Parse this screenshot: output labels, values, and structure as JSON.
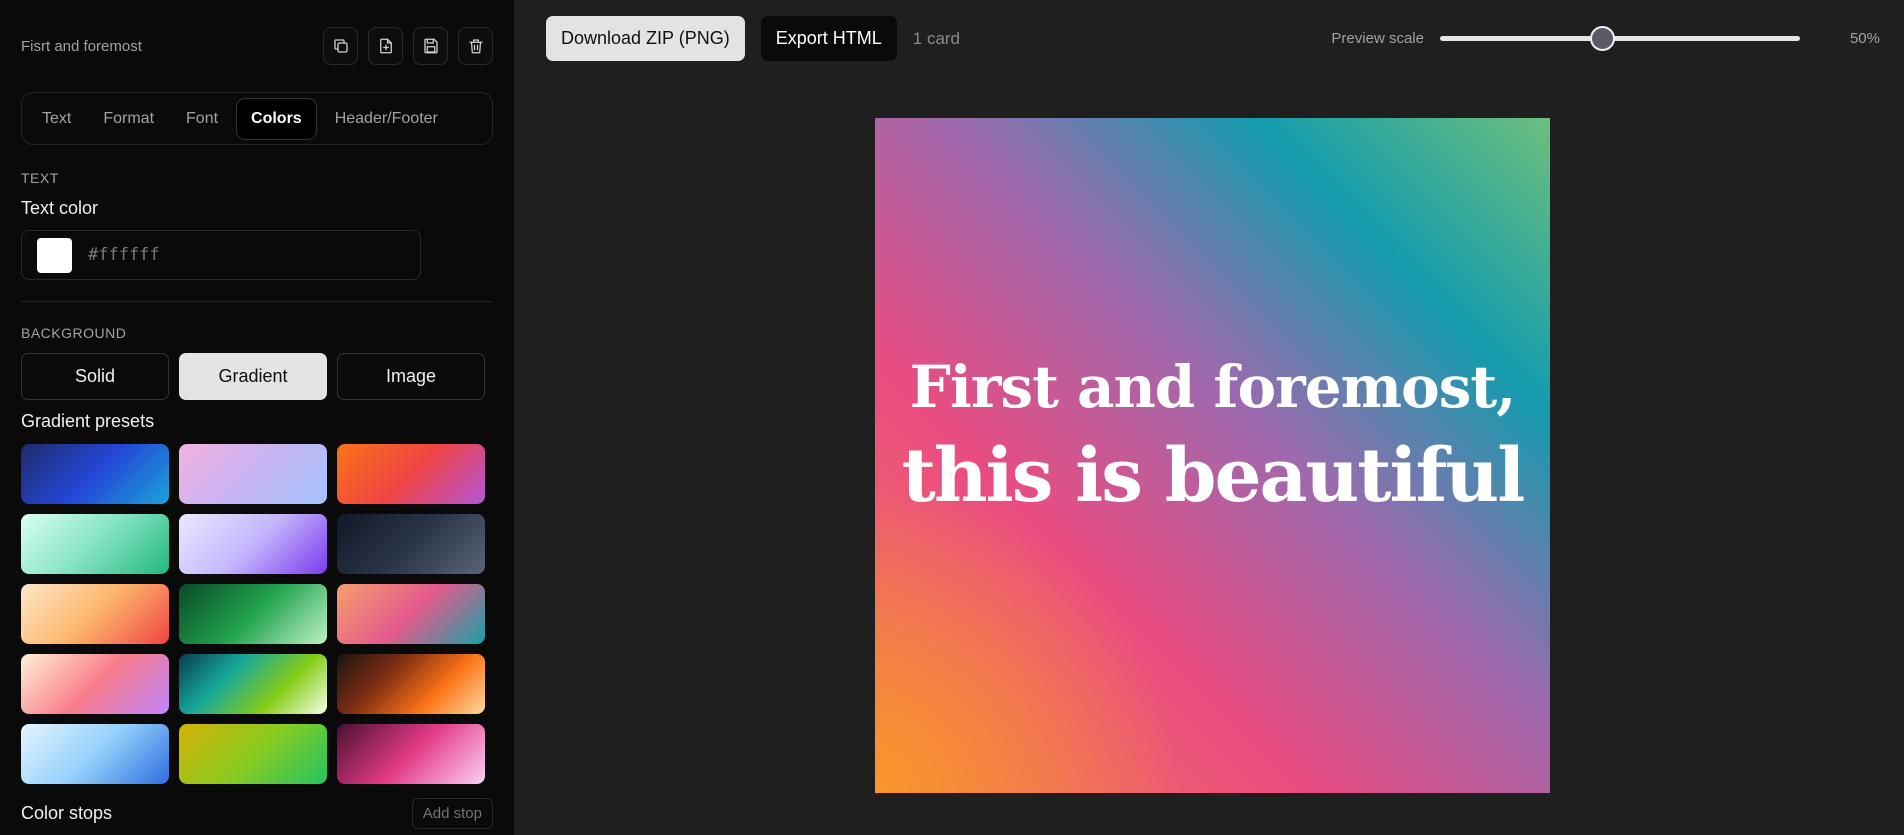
{
  "sidebar": {
    "deck_title": "Fisrt and foremost",
    "icons": [
      "duplicate-icon",
      "new-file-icon",
      "save-icon",
      "trash-icon"
    ],
    "tabs": [
      {
        "label": "Text"
      },
      {
        "label": "Format"
      },
      {
        "label": "Font"
      },
      {
        "label": "Colors",
        "active": true
      },
      {
        "label": "Header/Footer"
      }
    ],
    "text_section": {
      "heading": "TEXT",
      "text_color_label": "Text color",
      "text_color_value": "#ffffff"
    },
    "background_section": {
      "heading": "BACKGROUND",
      "modes": [
        "Solid",
        "Gradient",
        "Image"
      ],
      "active_mode": "Gradient",
      "presets_label": "Gradient presets",
      "presets": [
        [
          "#1e2a6b",
          "#2447d8",
          "#1aa3d8"
        ],
        [
          "#f2b1df",
          "#c7b4f5",
          "#a3c4fb"
        ],
        [
          "#f97316",
          "#ef4444",
          "#b455d8"
        ],
        [
          "#d9fff4",
          "#84e3c2",
          "#22b87d"
        ],
        [
          "#ede9fe",
          "#c4b5fd",
          "#7c3aed"
        ],
        [
          "#111827",
          "#2b3548",
          "#5a6478"
        ],
        [
          "#fde9c9",
          "#fdb46b",
          "#ef4444"
        ],
        [
          "#0b4a2a",
          "#21a34d",
          "#bff0c8"
        ],
        [
          "#f59e6b",
          "#e55a8c",
          "#16a2a8"
        ],
        [
          "#fff1d6",
          "#f87d8b",
          "#c084fc"
        ],
        [
          "#083c52",
          "#17a89a",
          "#84cc16",
          "#f7fee7"
        ],
        [
          "#1c1410",
          "#7c2d12",
          "#f97316",
          "#fdd9a0"
        ],
        [
          "#e6f4ff",
          "#93d0fb",
          "#2f6fe0"
        ],
        [
          "#d4b106",
          "#8acb20",
          "#22c55e"
        ],
        [
          "#4a1030",
          "#e23b86",
          "#fbd1f4"
        ]
      ],
      "stops_label": "Color stops",
      "add_stop_label": "Add stop"
    }
  },
  "toolbar": {
    "download_label": "Download ZIP (PNG)",
    "export_label": "Export HTML",
    "card_count": "1 card",
    "scale_label": "Preview scale",
    "scale_value": "50%",
    "scale_fraction": 0.45
  },
  "card": {
    "line1": "First and foremost,",
    "line2": "this is beautiful",
    "text_color": "#ffffff"
  }
}
